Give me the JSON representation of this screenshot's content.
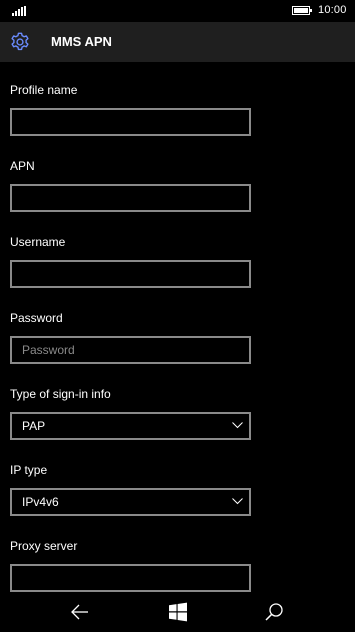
{
  "status_bar": {
    "time": "10:00",
    "icons": [
      "signal-icon",
      "battery-icon"
    ]
  },
  "app_bar": {
    "icon": "gear-icon",
    "title": "MMS APN"
  },
  "form": {
    "profile_name": {
      "label": "Profile name",
      "value": "",
      "placeholder": ""
    },
    "apn": {
      "label": "APN",
      "value": "",
      "placeholder": ""
    },
    "username": {
      "label": "Username",
      "value": "",
      "placeholder": ""
    },
    "password": {
      "label": "Password",
      "value": "",
      "placeholder": "Password"
    },
    "sign_in_type": {
      "label": "Type of sign-in info",
      "selected": "PAP"
    },
    "ip_type": {
      "label": "IP type",
      "selected": "IPv4v6"
    },
    "proxy_server": {
      "label": "Proxy server",
      "value": "",
      "placeholder": ""
    }
  },
  "nav_bar": {
    "icons": [
      "back-arrow-icon",
      "windows-start-icon",
      "search-icon"
    ]
  },
  "colors": {
    "background": "#000000",
    "app_bar": "#1f1f1f",
    "accent": "#6b8cff",
    "input_border": "#8a8a8a",
    "text": "#ffffff"
  }
}
